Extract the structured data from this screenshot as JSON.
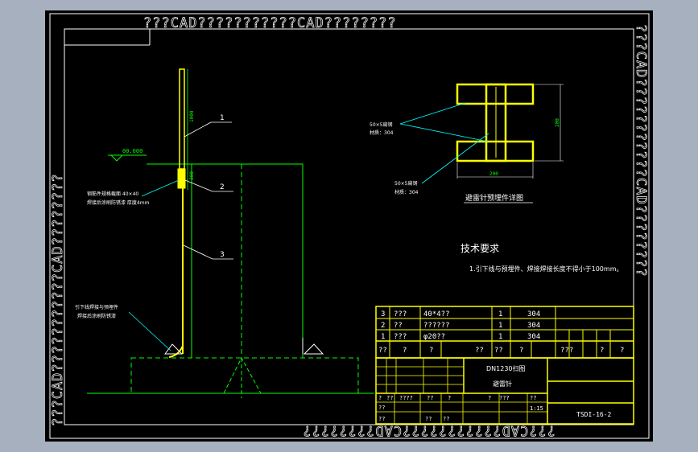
{
  "watermark": {
    "top": "???CAD???????????CAD????????",
    "bottom": "???CAD???????????CAD????????",
    "left": "???CAD???????????CAD????????",
    "right": "???CAD???????????CAD????????"
  },
  "elevation": {
    "level_label": "00.000",
    "dim_top": "1000",
    "dim_mid": "300",
    "callouts": [
      "1",
      "2",
      "3"
    ],
    "note_steel": "钢筋件规格截面 40×40",
    "note_weld": "焊接后涂刷防锈漆 厚度4mm",
    "note_bottom_1": "引下线焊接与预埋件",
    "note_bottom_2": "焊接后涂刷防锈漆"
  },
  "detail": {
    "label_a_1": "50×5扁钢",
    "label_a_2": "材质：304",
    "label_b_1": "50×5扁钢",
    "label_b_2": "材质：304",
    "dim_height": "200",
    "dim_width": "200",
    "caption": "避雷针预埋件详图"
  },
  "requirements": {
    "title": "技术要求",
    "item_1": "1.引下线与预埋件、焊接焊接长度不得小于100mm。"
  },
  "parts_table": {
    "rows": [
      {
        "no": "3",
        "name": "???",
        "spec": "40*4??",
        "qty": "1",
        "material": "304"
      },
      {
        "no": "2",
        "name": "??",
        "spec": "??????",
        "qty": "1",
        "material": "304"
      },
      {
        "no": "1",
        "name": "???",
        "spec": "φ20??",
        "qty": "1",
        "material": "304"
      }
    ],
    "header": [
      "??",
      "?",
      "?",
      "??",
      "??",
      "?",
      "???",
      "?",
      "?"
    ]
  },
  "title_block": {
    "project": "DN1230扫图",
    "part_name": "避雷针",
    "drawing_no": "TSDI-16-2",
    "scale": "1:15",
    "cells": [
      "?",
      "??",
      "????",
      "??",
      "?",
      "?",
      "???",
      "??",
      "??",
      "??",
      "??",
      "??"
    ]
  },
  "colors": {
    "background": "#000000",
    "frame": "#ffffff",
    "yellow": "#ffff00",
    "green": "#00ff00",
    "cyan": "#00ffff",
    "label_cyan": "#00ffff",
    "outer": "#a7b0bf"
  }
}
